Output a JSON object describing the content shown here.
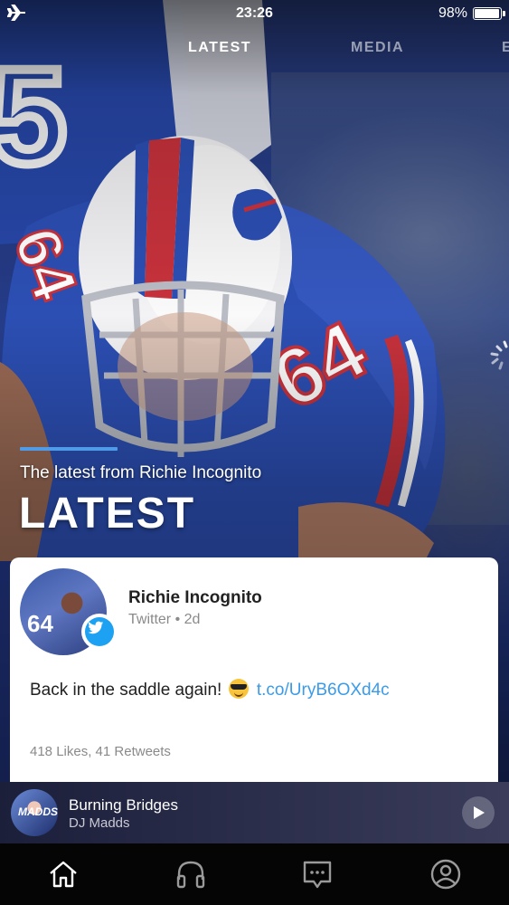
{
  "status_bar": {
    "time": "23:26",
    "battery_percent": "98%",
    "battery_level": 0.98,
    "icons": [
      "airplane-mode-icon",
      "battery-icon"
    ]
  },
  "tabs": [
    {
      "label": "LATEST",
      "active": true
    },
    {
      "label": "MEDIA",
      "active": false
    },
    {
      "label": "E",
      "active": false
    }
  ],
  "hero": {
    "subtitle": "The latest from Richie Incognito",
    "title": "LATEST",
    "jersey_number": "64",
    "accent_color": "#4f9be8"
  },
  "post": {
    "author": "Richie Incognito",
    "source": "Twitter",
    "separator": "•",
    "age": "2d",
    "text": "Back in the saddle again!",
    "emoji": "smiling-face-with-sunglasses",
    "link": "t.co/UryB6OXd4c",
    "stats": "418 Likes, 41 Retweets",
    "link_color": "#3b9be8",
    "source_badge_color": "#1da1f2"
  },
  "player": {
    "track": "Burning Bridges",
    "artist": "DJ Madds",
    "art_text": "MADDS",
    "play_icon": "play-icon"
  },
  "bottom_nav": [
    {
      "icon": "home-icon",
      "active": true
    },
    {
      "icon": "headphones-icon",
      "active": false
    },
    {
      "icon": "chat-icon",
      "active": false
    },
    {
      "icon": "profile-icon",
      "active": false
    }
  ]
}
